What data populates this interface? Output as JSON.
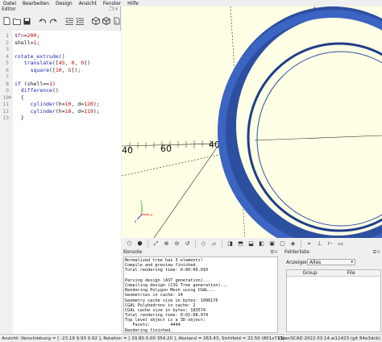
{
  "menu": [
    "Datei",
    "Bearbeiten",
    "Design",
    "Ansicht",
    "Fenster",
    "Hilfe"
  ],
  "editor": {
    "title": "Editor",
    "window_buttons": "❐×",
    "toolbar_icons": [
      "new-file-icon",
      "open-file-icon",
      "save-icon",
      "undo-icon",
      "redo-icon",
      "indent-icon",
      "unindent-icon",
      "preview-icon",
      "render-icon",
      "export-icon"
    ],
    "lines": [
      {
        "n": "1",
        "fold": "",
        "parts": [
          {
            "t": "$fn",
            "c": "var"
          },
          {
            "t": "=",
            "c": "plain"
          },
          {
            "t": "200",
            "c": "num"
          },
          {
            "t": ";",
            "c": "plain"
          }
        ]
      },
      {
        "n": "2",
        "fold": "",
        "parts": [
          {
            "t": "shell",
            "c": "plain"
          },
          {
            "t": "=",
            "c": "plain"
          },
          {
            "t": "1",
            "c": "num"
          },
          {
            "t": ";",
            "c": "plain"
          }
        ]
      },
      {
        "n": "3",
        "fold": "",
        "parts": []
      },
      {
        "n": "4",
        "fold": "",
        "parts": [
          {
            "t": "rotate_extrude",
            "c": "kw"
          },
          {
            "t": "()",
            "c": "plain"
          }
        ]
      },
      {
        "n": "5",
        "fold": "",
        "parts": [
          {
            "t": "   translate",
            "c": "kw"
          },
          {
            "t": "([",
            "c": "plain"
          },
          {
            "t": "45",
            "c": "num"
          },
          {
            "t": ", ",
            "c": "plain"
          },
          {
            "t": "0",
            "c": "num"
          },
          {
            "t": ", ",
            "c": "plain"
          },
          {
            "t": "0",
            "c": "num"
          },
          {
            "t": "])",
            "c": "plain"
          }
        ]
      },
      {
        "n": "6",
        "fold": "",
        "parts": [
          {
            "t": "     square",
            "c": "kw"
          },
          {
            "t": "([",
            "c": "plain"
          },
          {
            "t": "10",
            "c": "num"
          },
          {
            "t": ", ",
            "c": "plain"
          },
          {
            "t": "5",
            "c": "num"
          },
          {
            "t": "]);",
            "c": "plain"
          }
        ]
      },
      {
        "n": "7",
        "fold": "",
        "parts": []
      },
      {
        "n": "8",
        "fold": "",
        "parts": [
          {
            "t": "if ",
            "c": "kw"
          },
          {
            "t": "(shell==",
            "c": "plain"
          },
          {
            "t": "1",
            "c": "num"
          },
          {
            "t": ")",
            "c": "plain"
          }
        ]
      },
      {
        "n": "9",
        "fold": "",
        "parts": [
          {
            "t": "  difference",
            "c": "kw"
          },
          {
            "t": "()",
            "c": "plain"
          }
        ]
      },
      {
        "n": "10",
        "fold": "⊟",
        "parts": [
          {
            "t": "  {",
            "c": "plain"
          }
        ]
      },
      {
        "n": "11",
        "fold": "",
        "parts": [
          {
            "t": "     cylinder",
            "c": "kw"
          },
          {
            "t": "(h=",
            "c": "plain"
          },
          {
            "t": "10",
            "c": "num"
          },
          {
            "t": ", d=",
            "c": "plain"
          },
          {
            "t": "120",
            "c": "num"
          },
          {
            "t": ");",
            "c": "plain"
          }
        ]
      },
      {
        "n": "12",
        "fold": "",
        "parts": [
          {
            "t": "     cylinder",
            "c": "kw"
          },
          {
            "t": "(h=",
            "c": "plain"
          },
          {
            "t": "10",
            "c": "num"
          },
          {
            "t": ", d=",
            "c": "plain"
          },
          {
            "t": "119",
            "c": "num"
          },
          {
            "t": ");",
            "c": "plain"
          }
        ]
      },
      {
        "n": "13",
        "fold": "",
        "parts": [
          {
            "t": "  }",
            "c": "plain"
          }
        ]
      }
    ]
  },
  "viewport": {
    "background_color": "#ffffe5",
    "ring_color": "#3a5fb8",
    "ring_inner_color": "#2a4a9a",
    "axis_labels": [
      "40",
      "60",
      "40",
      "40",
      "60"
    ]
  },
  "view_toolbar_icons": [
    "preview-icon",
    "render-icon",
    "zoom-all-icon",
    "zoom-in-icon",
    "zoom-out-icon",
    "reset-view-icon",
    "perspective-icon",
    "orthogonal-icon",
    "view-right-icon",
    "view-top-icon",
    "view-bottom-icon",
    "view-left-icon",
    "view-front-icon",
    "view-back-icon",
    "diagonal-icon",
    "center-icon",
    "axes-icon",
    "scale-markers-icon",
    "edges-icon"
  ],
  "console": {
    "title": "Konsole",
    "lines": [
      "Normalized tree has 3 elements!",
      "Compile and preview finished.",
      "Total rendering time: 0:00:00.010",
      "",
      "Parsing design (AST generation)...",
      "Compiling design (CSG Tree generation)...",
      "Rendering Polygon Mesh using CGAL...",
      "Geometries in cache: 14",
      "Geometry cache size in bytes: 1090176",
      "CGAL Polyhedrons in cache: 2",
      "CGAL cache size in bytes: 183574",
      "Total rendering time: 0:01:08.974",
      "Top level object is a 3D object:",
      "   Facets:        4444",
      "Rendering finished."
    ]
  },
  "errors": {
    "title": "Fehlerliste",
    "show_label": "Anzeigen",
    "show_value": "Alles",
    "columns": [
      "Group",
      "File"
    ]
  },
  "status": {
    "left": "Ansicht: Verschiebung = [ -23.19 9.93 0.92 ], Rotation = [ 29.80 0.00 354.20 ], Abstand = 263.43, Sichtfeld = 22.50 (801x713)",
    "right": "OpenSCAD 2022.03.14.ai11423 (git 84e3dcb)"
  }
}
